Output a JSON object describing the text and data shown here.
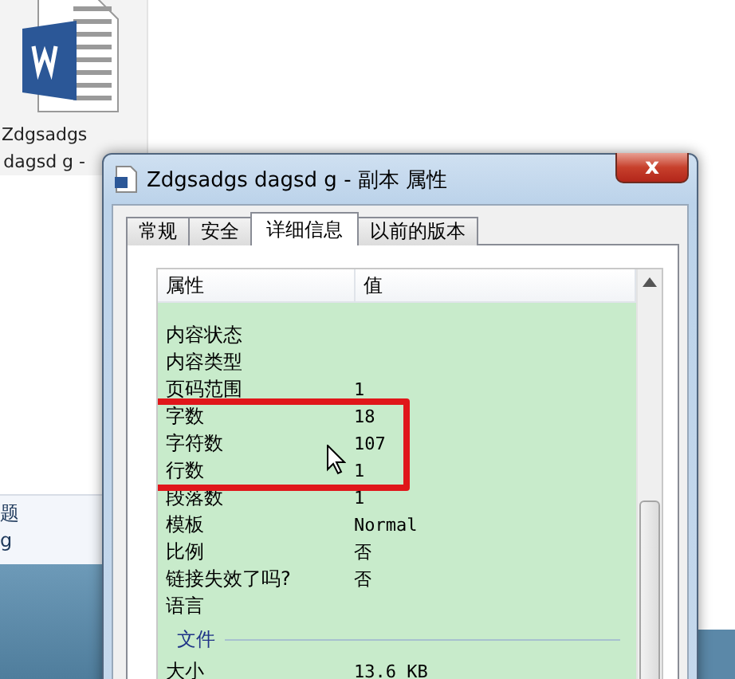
{
  "desktop": {
    "file_label_lines": [
      "Zdgsadgs",
      "dagsd g -"
    ],
    "details_lines": [
      "题",
      "g"
    ]
  },
  "dialog": {
    "title": "Zdgsadgs dagsd g - 副本 属性",
    "close": "x",
    "tabs": [
      {
        "label": "常规",
        "selected": false
      },
      {
        "label": "安全",
        "selected": false
      },
      {
        "label": "详细信息",
        "selected": true
      },
      {
        "label": "以前的版本",
        "selected": false
      }
    ],
    "columns": [
      "属性",
      "值"
    ],
    "rows": [
      {
        "kind": "row",
        "name": "内容状态"
      },
      {
        "kind": "row",
        "name": "内容类型"
      },
      {
        "kind": "row",
        "name": "页码范围",
        "value": "1"
      },
      {
        "kind": "row",
        "name": "字数",
        "value": "18",
        "highlighted": true
      },
      {
        "kind": "row",
        "name": "字符数",
        "value": "107",
        "highlighted": true
      },
      {
        "kind": "row",
        "name": "行数",
        "value": "1",
        "highlighted": true
      },
      {
        "kind": "row",
        "name": "段落数",
        "value": "1"
      },
      {
        "kind": "row",
        "name": "模板",
        "value": "Normal"
      },
      {
        "kind": "row",
        "name": "比例",
        "value": "否"
      },
      {
        "kind": "row",
        "name": "链接失效了吗?",
        "value": "否"
      },
      {
        "kind": "row",
        "name": "语言"
      },
      {
        "kind": "group",
        "name": "文件"
      },
      {
        "kind": "row",
        "name": "大小",
        "value": "13.6 KB"
      }
    ]
  }
}
